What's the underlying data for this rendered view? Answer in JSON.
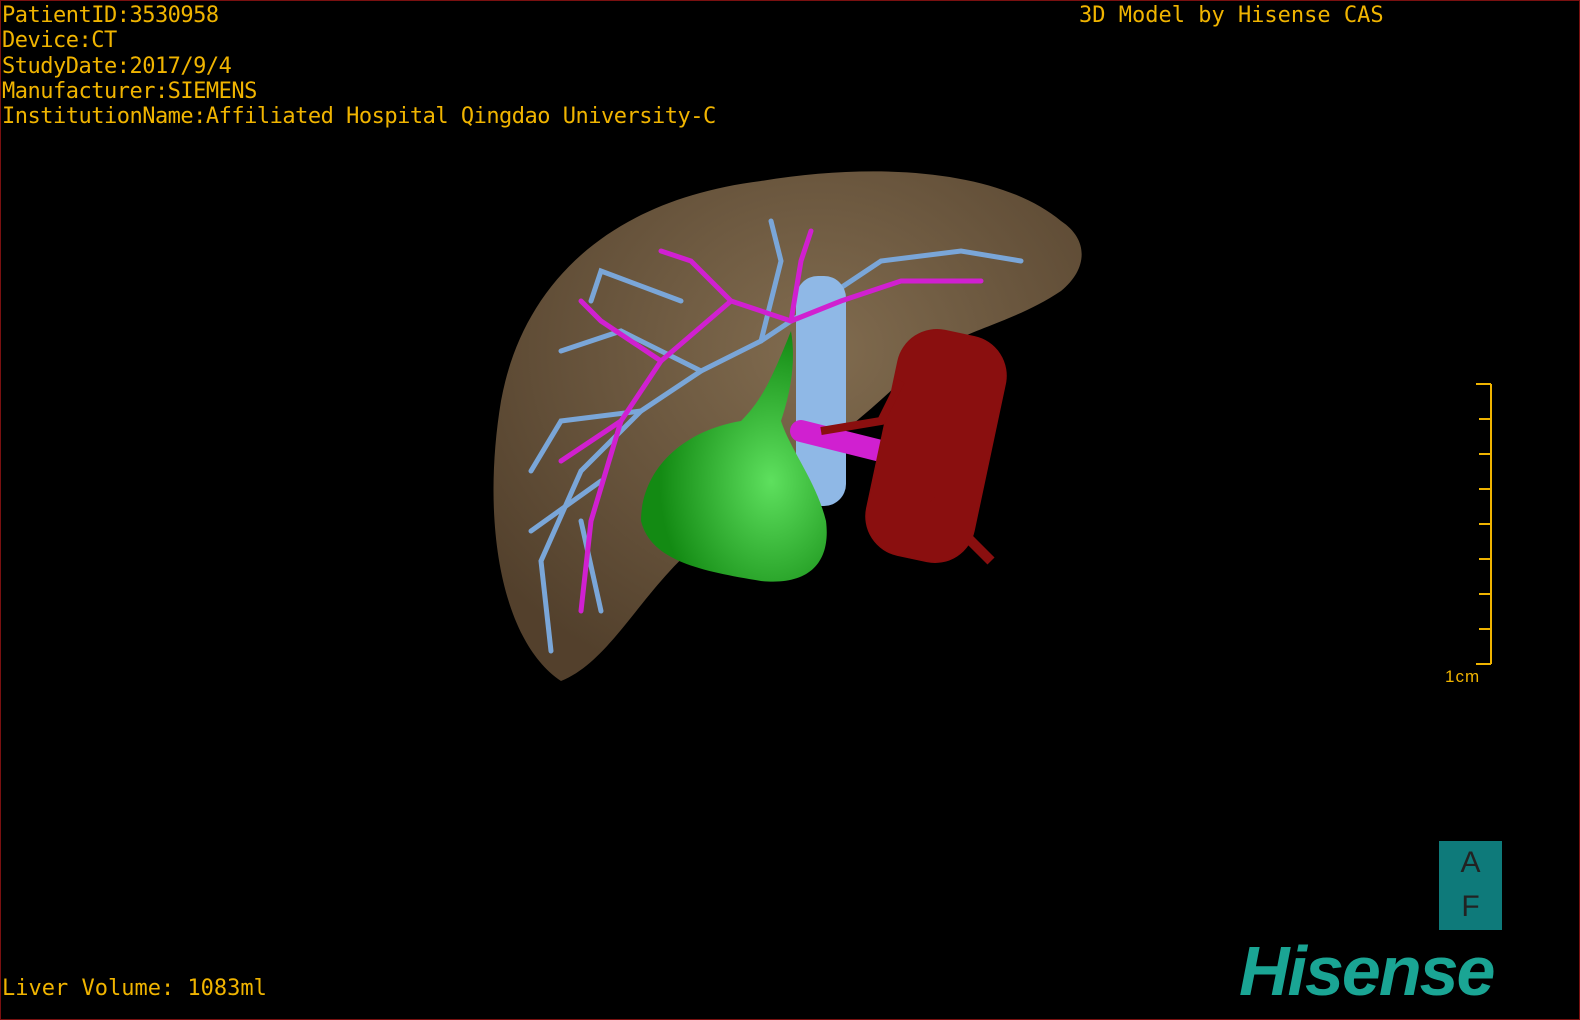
{
  "patient_info": {
    "patient_id": "PatientID:3530958",
    "device": "Device:CT",
    "study_date": "StudyDate:2017/9/4",
    "manufacturer": "Manufacturer:SIEMENS",
    "institution": "InstitutionName:Affiliated Hospital Qingdao University-C"
  },
  "brand_text": "3D Model by Hisense CAS",
  "liver_volume": "Liver Volume: 1083ml",
  "scale_bar": {
    "label": "1cm",
    "ticks": 9
  },
  "orientation": {
    "top": "A",
    "bottom": "F"
  },
  "logo": "Hisense",
  "colors": {
    "text": "#f0b400",
    "liver": "#7a6548",
    "portal_vein": "#7aa6d8",
    "hepatic_vein": "#d020d0",
    "gallbladder_tumor": "#1fa01f",
    "artery": "#8a0f0f",
    "logo": "#1aa594"
  }
}
